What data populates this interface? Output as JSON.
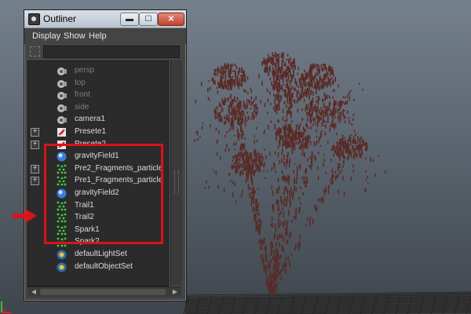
{
  "window": {
    "title": "Outliner",
    "controls": {
      "minimize": "▬",
      "maximize": "☐",
      "close": "✕"
    }
  },
  "menu": [
    "Display",
    "Show",
    "Help"
  ],
  "outliner_items": [
    {
      "label": "persp",
      "icon": "camera-icon",
      "expandable": false,
      "dimmed": true
    },
    {
      "label": "top",
      "icon": "camera-icon",
      "expandable": false,
      "dimmed": true
    },
    {
      "label": "front",
      "icon": "camera-icon",
      "expandable": false,
      "dimmed": true
    },
    {
      "label": "side",
      "icon": "camera-icon",
      "expandable": false,
      "dimmed": true
    },
    {
      "label": "camera1",
      "icon": "camera-icon",
      "expandable": false,
      "dimmed": false
    },
    {
      "label": "Presete1",
      "icon": "transform-icon",
      "expandable": true,
      "dimmed": false
    },
    {
      "label": "Presete2",
      "icon": "transform-icon",
      "expandable": true,
      "dimmed": false
    },
    {
      "label": "gravityField1",
      "icon": "field-icon",
      "expandable": false,
      "dimmed": false
    },
    {
      "label": "Pre2_Fragments_particle",
      "icon": "particle-icon",
      "expandable": true,
      "dimmed": false
    },
    {
      "label": "Pre1_Fragments_particle",
      "icon": "particle-icon",
      "expandable": true,
      "dimmed": false
    },
    {
      "label": "gravityField2",
      "icon": "field-icon",
      "expandable": false,
      "dimmed": false
    },
    {
      "label": "Trail1",
      "icon": "particle-icon",
      "expandable": false,
      "dimmed": false
    },
    {
      "label": "Trail2",
      "icon": "particle-icon",
      "expandable": false,
      "dimmed": false
    },
    {
      "label": "Spark1",
      "icon": "particle-icon",
      "expandable": false,
      "dimmed": false
    },
    {
      "label": "Spark2",
      "icon": "particle-icon",
      "expandable": false,
      "dimmed": false
    },
    {
      "label": "defaultLightSet",
      "icon": "set-icon",
      "expandable": false,
      "dimmed": false
    },
    {
      "label": "defaultObjectSet",
      "icon": "set-icon",
      "expandable": false,
      "dimmed": false
    }
  ],
  "expander_symbol": "+",
  "scrollbar": {
    "left_arrow": "◀",
    "right_arrow": "▶"
  },
  "colors": {
    "highlight": "#d7141a",
    "particles": "#5a2a26",
    "list_bg": "#2b2b2b"
  }
}
